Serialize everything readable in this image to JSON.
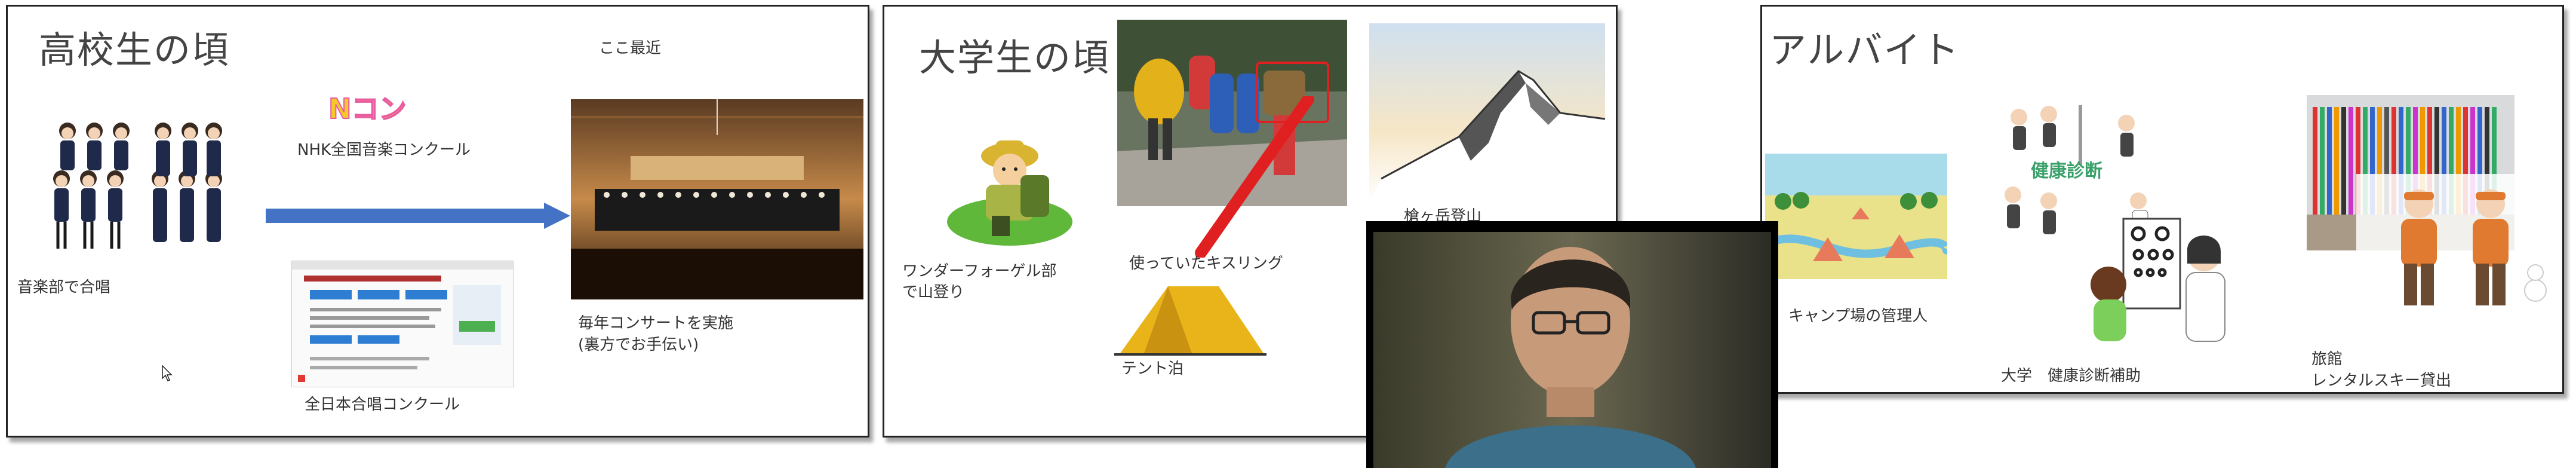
{
  "slide1": {
    "title": "高校生の頃",
    "recent_label": "ここ最近",
    "ncon_logo": "Nコン",
    "ncon_caption": "NHK全国音楽コンクール",
    "choir_caption": "音楽部で合唱",
    "concert_caption_line1": "毎年コンサートを実施",
    "concert_caption_line2": "(裏方でお手伝い)",
    "zennihon_caption": "全日本合唱コンクール",
    "arrow_color": "#4472c4"
  },
  "slide2": {
    "title": "大学生の頃",
    "wandervogel_line1": "ワンダーフォーゲル部",
    "wandervogel_line2": "で山登り",
    "backpack_caption": "使っていたキスリング",
    "tent_caption": "テント泊",
    "mountain_caption": "槍ヶ岳登山",
    "highlight_color": "#e02020"
  },
  "slide3": {
    "title": "アルバイト",
    "camp_caption": "キャンプ場の管理人",
    "health_sign": "健康診断",
    "health_caption": "大学　健康診断補助",
    "ryokan_line1": "旅館",
    "ryokan_line2": "レンタルスキー貸出"
  },
  "cursor": {
    "icon": "mouse-pointer-icon"
  }
}
